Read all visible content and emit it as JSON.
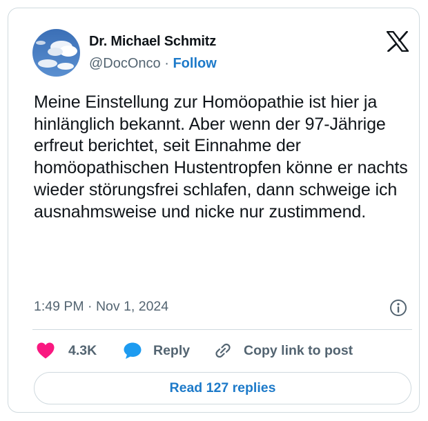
{
  "author": {
    "name": "Dr. Michael Schmitz",
    "handle": "@DocOnco",
    "separator": "·",
    "follow_label": "Follow"
  },
  "logo_icon": "x-logo-icon",
  "tweet": {
    "text": "Meine Einstellung zur Homöopathie ist hier ja hinlänglich bekannt. Aber wenn der 97-Jährige erfreut berichtet, seit Einnahme der homöopathischen Hustentropfen könne er nachts wieder störungsfrei schlafen, dann schweige ich ausnahmsweise und nicke nur zustimmend.",
    "time": "1:49 PM",
    "separator": "·",
    "date": "Nov 1, 2024"
  },
  "actions": {
    "likes_count": "4.3K",
    "reply_label": "Reply",
    "copy_label": "Copy link to post"
  },
  "replies_button_label": "Read 127 replies",
  "colors": {
    "accent": "#1d7ac9",
    "heart": "#f91880",
    "reply_icon": "#1d9bf0",
    "muted_text": "#536471",
    "border": "#cfd9de"
  }
}
